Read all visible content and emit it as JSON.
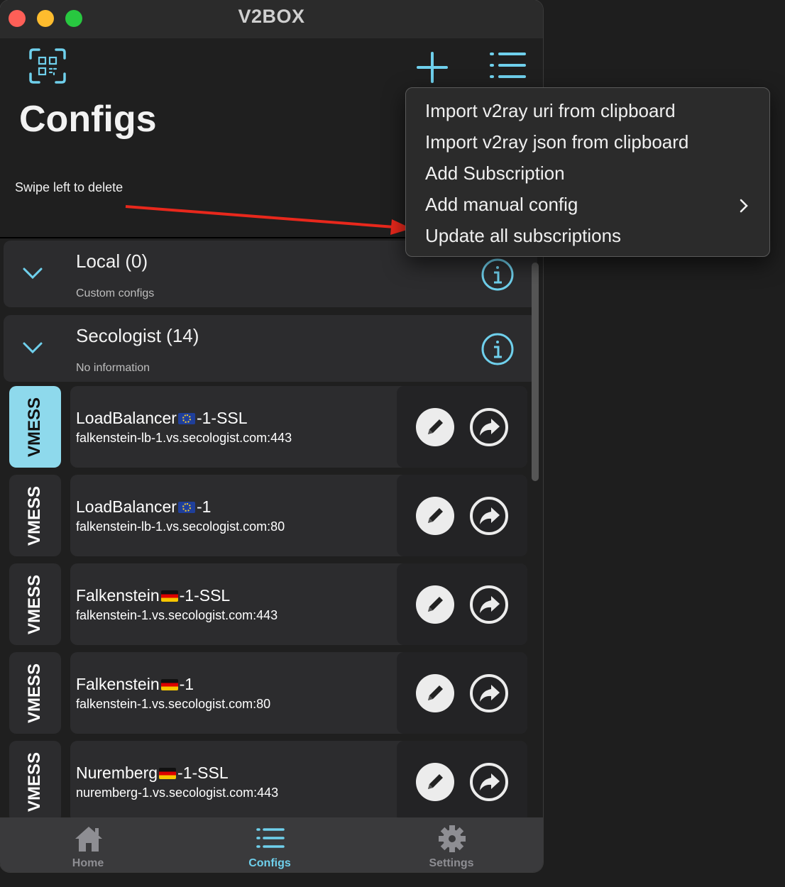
{
  "window": {
    "title": "V2BOX"
  },
  "header": {
    "title": "Configs",
    "hint": "Swipe left to delete",
    "icons": {
      "qr": "qr-scan-icon",
      "add": "plus-icon",
      "menu": "list-icon"
    }
  },
  "groups": [
    {
      "name": "Local (0)",
      "subtitle": "Custom configs"
    },
    {
      "name": "Secologist (14)",
      "subtitle": "No information"
    }
  ],
  "configs": [
    {
      "protocol": "VMESS",
      "name_before": "LoadBalancer",
      "flag": "EU",
      "name_after": "-1-SSL",
      "address": "falkenstein-lb-1.vs.secologist.com:443",
      "selected": true
    },
    {
      "protocol": "VMESS",
      "name_before": "LoadBalancer",
      "flag": "EU",
      "name_after": "-1",
      "address": "falkenstein-lb-1.vs.secologist.com:80",
      "selected": false
    },
    {
      "protocol": "VMESS",
      "name_before": "Falkenstein",
      "flag": "DE",
      "name_after": "-1-SSL",
      "address": "falkenstein-1.vs.secologist.com:443",
      "selected": false
    },
    {
      "protocol": "VMESS",
      "name_before": "Falkenstein",
      "flag": "DE",
      "name_after": "-1",
      "address": "falkenstein-1.vs.secologist.com:80",
      "selected": false
    },
    {
      "protocol": "VMESS",
      "name_before": "Nuremberg",
      "flag": "DE",
      "name_after": "-1-SSL",
      "address": "nuremberg-1.vs.secologist.com:443",
      "selected": false
    }
  ],
  "menu": {
    "items": [
      "Import v2ray uri from clipboard",
      "Import v2ray json from clipboard",
      "Add Subscription",
      "Add manual config",
      "Update all subscriptions"
    ]
  },
  "tabs": [
    {
      "label": "Home",
      "icon": "home-icon",
      "active": false
    },
    {
      "label": "Configs",
      "icon": "list-icon",
      "active": true
    },
    {
      "label": "Settings",
      "icon": "gear-icon",
      "active": false
    }
  ],
  "colors": {
    "accent": "#6fd0ec",
    "selected_tag": "#8ed9ec",
    "annotation_arrow": "#e8281c"
  }
}
